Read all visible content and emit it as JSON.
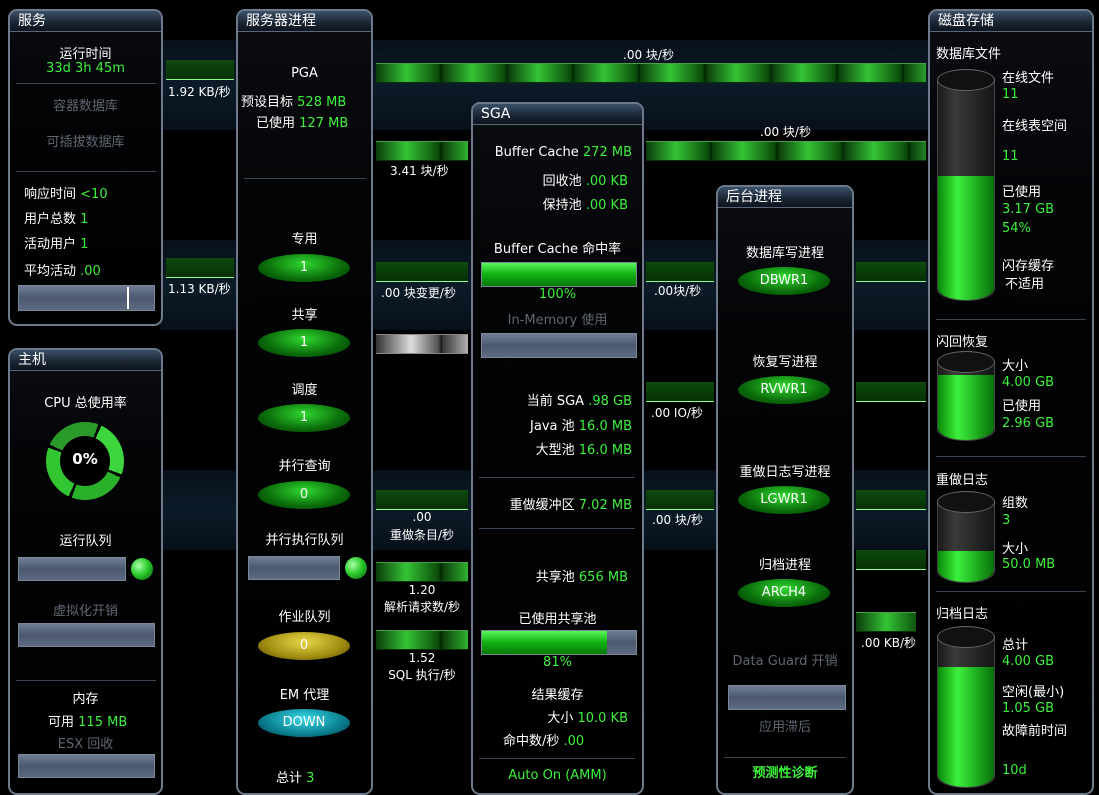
{
  "services": {
    "title": "服务",
    "uptime_label": "运行时间",
    "uptime_value": "33d 3h 45m",
    "container_db": "容器数据库",
    "pluggable_db": "可插拔数据库",
    "response_time_label": "响应时间",
    "response_time_value": "<10",
    "total_users_label": "用户总数",
    "total_users_value": "1",
    "active_users_label": "活动用户",
    "active_users_value": "1",
    "avg_active_label": "平均活动",
    "avg_active_value": ".00"
  },
  "host": {
    "title": "主机",
    "cpu_label": "CPU 总使用率",
    "cpu_value": "0%",
    "run_queue_label": "运行队列",
    "virt_label": "虚拟化开销",
    "memory_label": "内存",
    "available_label": "可用",
    "available_value": "115 MB",
    "esx_label": "ESX 回收"
  },
  "server": {
    "title": "服务器进程",
    "pga_label": "PGA",
    "pga_target_label": "预设目标",
    "pga_target_value": "528 MB",
    "pga_used_label": "已使用",
    "pga_used_value": "127 MB",
    "dedicated_label": "专用",
    "dedicated_value": "1",
    "shared_label": "共享",
    "shared_value": "1",
    "dispatch_label": "调度",
    "dispatch_value": "1",
    "parallel_label": "并行查询",
    "parallel_value": "0",
    "parallel_queue_label": "并行执行队列",
    "job_queue_label": "作业队列",
    "job_queue_value": "0",
    "em_label": "EM 代理",
    "em_value": "DOWN",
    "total_label": "总计",
    "total_value": "3"
  },
  "sga": {
    "title": "SGA",
    "buffer_cache_label": "Buffer Cache",
    "buffer_cache_value": "272 MB",
    "recycle_label": "回收池",
    "recycle_value": ".00 KB",
    "keep_label": "保持池",
    "keep_value": ".00 KB",
    "hit_label": "Buffer Cache 命中率",
    "hit_value": "100%",
    "hit_fraction": 1.0,
    "inmem_label": "In-Memory 使用",
    "current_label": "当前 SGA",
    "current_value": ".98 GB",
    "java_label": "Java 池",
    "java_value": "16.0 MB",
    "large_label": "大型池",
    "large_value": "16.0 MB",
    "redo_buf_label": "重做缓冲区",
    "redo_buf_value": "7.02 MB",
    "shared_pool_label": "共享池",
    "shared_pool_value": "656 MB",
    "used_shared_label": "已使用共享池",
    "used_shared_value": "81%",
    "used_shared_fraction": 0.81,
    "result_cache_label": "结果缓存",
    "rc_size_label": "大小",
    "rc_size_value": "10.0 KB",
    "rc_hits_label": "命中数/秒",
    "rc_hits_value": ".00",
    "mode": "Auto On (AMM)"
  },
  "bg": {
    "title": "后台进程",
    "dbwr_label": "数据库写进程",
    "dbwr_value": "DBWR1",
    "rvwr_label": "恢复写进程",
    "rvwr_value": "RVWR1",
    "lgwr_label": "重做日志写进程",
    "lgwr_value": "LGWR1",
    "arch_label": "归档进程",
    "arch_value": "ARCH4",
    "dg_label": "Data Guard 开销",
    "apply_lag_label": "应用滞后",
    "diag_link": "预测性诊断"
  },
  "disk": {
    "title": "磁盘存储",
    "dbfiles_label": "数据库文件",
    "online_files_label": "在线文件",
    "online_files_value": "11",
    "online_ts_label": "在线表空间",
    "online_ts_value": "11",
    "used_label": "已使用",
    "used_value": "3.17 GB",
    "used_pct": "54%",
    "used_fraction": 0.54,
    "flash_label": "闪存缓存",
    "flash_value": "不适用",
    "flashback_label": "闪回恢复",
    "fb_size_label": "大小",
    "fb_size_value": "4.00 GB",
    "fb_used_label": "已使用",
    "fb_used_value": "2.96 GB",
    "fb_fraction": 0.74,
    "redo_label": "重做日志",
    "redo_groups_label": "组数",
    "redo_groups_value": "3",
    "redo_size_label": "大小",
    "redo_size_value": "50.0 MB",
    "redo_fraction": 0.35,
    "archive_label": "归档日志",
    "arch_total_label": "总计",
    "arch_total_value": "4.00 GB",
    "arch_free_label": "空闲(最小)",
    "arch_free_value": "1.05 GB",
    "arch_ttf_label": "故障前时间",
    "arch_ttf_value": "10d",
    "arch_fraction": 0.75
  },
  "flows": {
    "f1": "1.92 KB/秒",
    "f2": "1.13 KB/秒",
    "f3": ".00 块/秒",
    "f4": ".00 块/秒",
    "f5": "3.41 块/秒",
    "f6": ".00 块变更/秒",
    "f7": ".00块/秒",
    "f8": ".00 IO/秒",
    "f9": ".00 块/秒",
    "f10": ".00",
    "f10b": "重做条目/秒",
    "f11": "1.20",
    "f11b": "解析请求数/秒",
    "f12": "1.52",
    "f12b": "SQL 执行/秒",
    "f13": ".00 KB/秒"
  }
}
